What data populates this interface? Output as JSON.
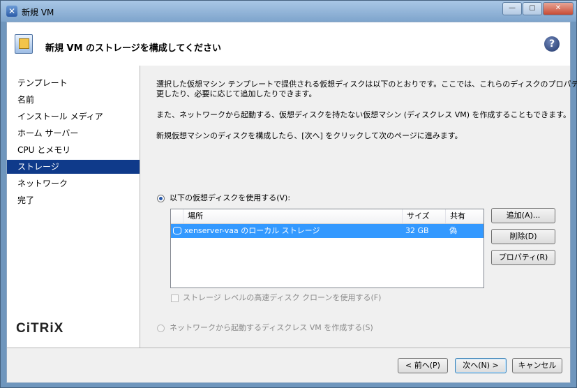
{
  "window": {
    "title": "新規 VM",
    "min_label": "—",
    "max_label": "▢",
    "close_label": "✕"
  },
  "header": {
    "title": "新規 VM のストレージを構成してください",
    "help_label": "?"
  },
  "sidebar": {
    "items": [
      {
        "label": "テンプレート"
      },
      {
        "label": "名前"
      },
      {
        "label": "インストール メディア"
      },
      {
        "label": "ホーム サーバー"
      },
      {
        "label": "CPU とメモリ"
      },
      {
        "label": "ストレージ",
        "selected": true
      },
      {
        "label": "ネットワーク"
      },
      {
        "label": "完了"
      }
    ],
    "logo_text": "CiTRiX"
  },
  "content": {
    "para1_line1": "選択した仮想マシン テンプレートで提供される仮想ディスクは以下のとおりです。ここでは、これらのディスクのプロパティを変",
    "para1_line2": "更したり、必要に応じて追加したりできます。",
    "para2": "また、ネットワークから起動する、仮想ディスクを持たない仮想マシン (ディスクレス VM) を作成することもできます。",
    "para3": "新規仮想マシンのディスクを構成したら、[次へ] をクリックして次のページに進みます。",
    "radio_use_disks": "以下の仮想ディスクを使用する(V):",
    "table": {
      "columns": [
        "場所",
        "サイズ",
        "共有"
      ],
      "rows": [
        {
          "location": "xenserver-vaa のローカル ストレージ",
          "size": "32 GB",
          "shared": "偽"
        }
      ]
    },
    "btn_add": "追加(A)...",
    "btn_delete": "削除(D)",
    "btn_properties": "プロパティ(R)",
    "checkbox_fast_clone": "ストレージ レベルの高速ディスク クローンを使用する(F)",
    "radio_diskless": "ネットワークから起動するディスクレス VM を作成する(S)"
  },
  "footer": {
    "back": "< 前へ(P)",
    "next": "次へ(N) >",
    "cancel": "キャンセル"
  },
  "colors": {
    "selection": "#0f3a8a",
    "row_highlight": "#3399ff"
  }
}
